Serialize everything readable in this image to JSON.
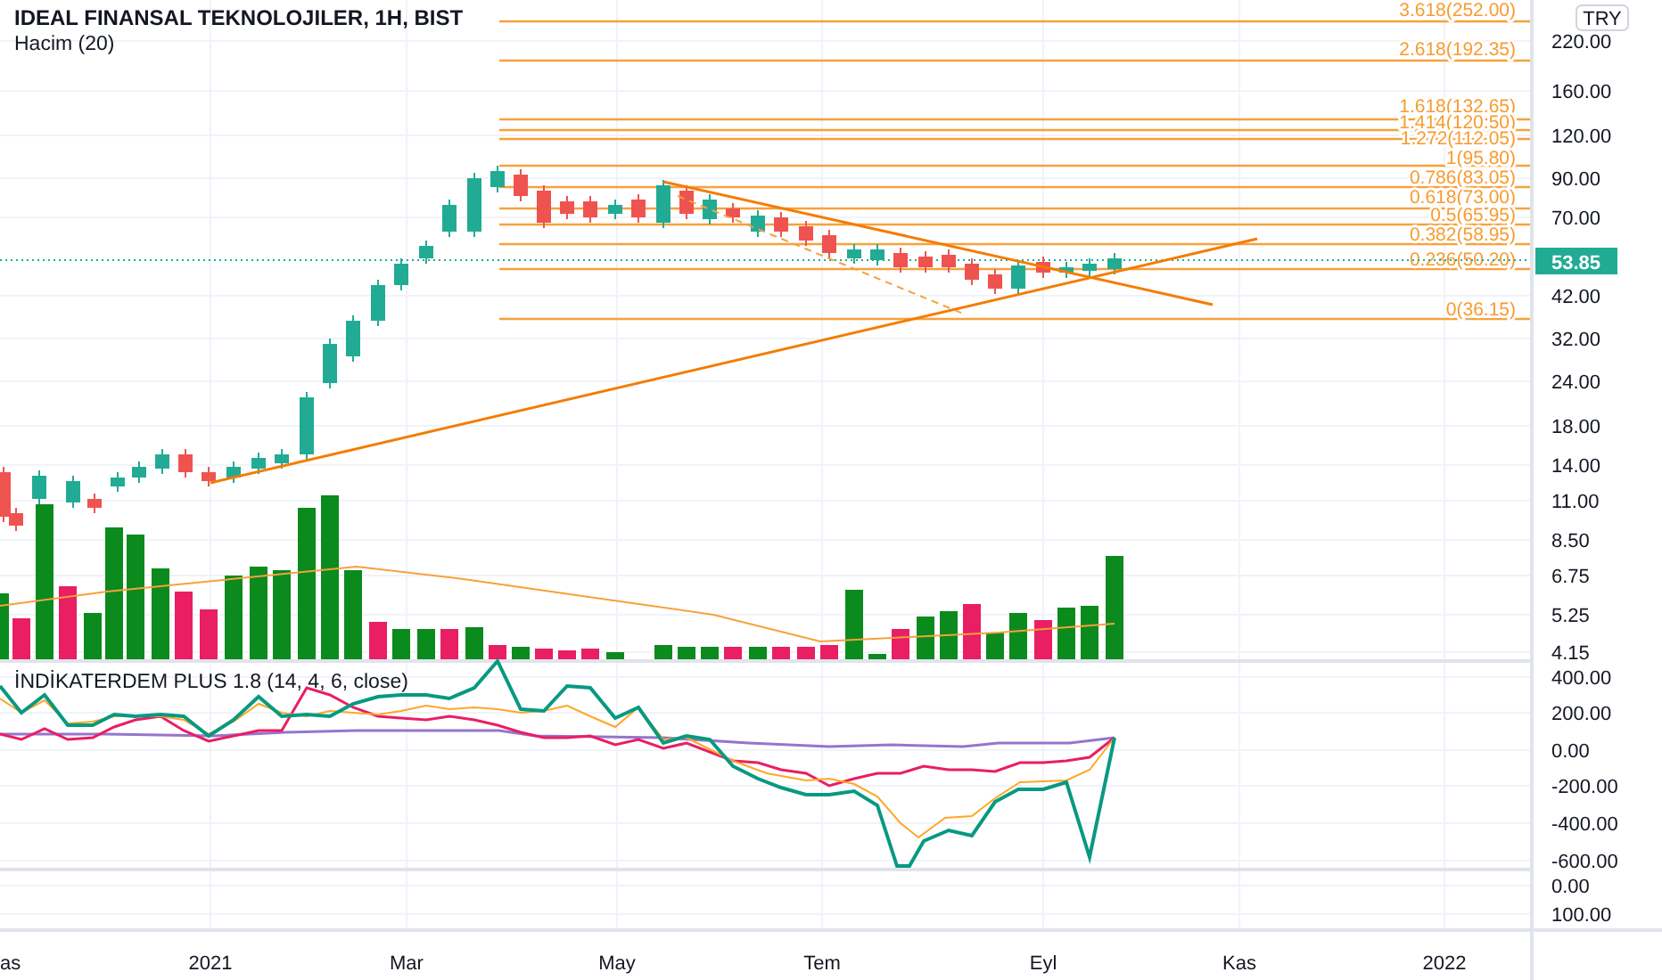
{
  "chart": {
    "title": "IDEAL FINANSAL TEKNOLOJILER, 1H, BIST",
    "volume_label": "Hacim (20)",
    "currency": "TRY",
    "price_badge": "53.85",
    "fib_levels": [
      {
        "label": "3.618(252.00)"
      },
      {
        "label": "2.618(192.35)"
      },
      {
        "label": "1.618(132.65)"
      },
      {
        "label": "1.414(120.50)"
      },
      {
        "label": "1.272(112.05)"
      },
      {
        "label": "1(95.80)"
      },
      {
        "label": "0.786(83.05)"
      },
      {
        "label": "0.618(73.00)"
      },
      {
        "label": "0.5(65.95)"
      },
      {
        "label": "0.382(58.95)"
      },
      {
        "label": "0.236(50.20)"
      },
      {
        "label": "0(36.15)"
      }
    ],
    "price_axis": [
      "220.00",
      "160.00",
      "120.00",
      "90.00",
      "70.00",
      "42.00",
      "32.00",
      "24.00",
      "18.00",
      "14.00",
      "11.00",
      "8.50",
      "6.75",
      "5.25",
      "4.15"
    ],
    "indicator": {
      "title": "İNDİKATERDEM PLUS 1.8 (14, 4, 6, close)",
      "axis": [
        "400.00",
        "200.00",
        "0.00",
        "-200.00",
        "-400.00",
        "-600.00"
      ]
    },
    "lower_axis": [
      "0.00",
      "100.00"
    ],
    "time_axis": [
      "as",
      "2021",
      "Mar",
      "May",
      "Tem",
      "Eyl",
      "Kas",
      "2022"
    ]
  }
}
